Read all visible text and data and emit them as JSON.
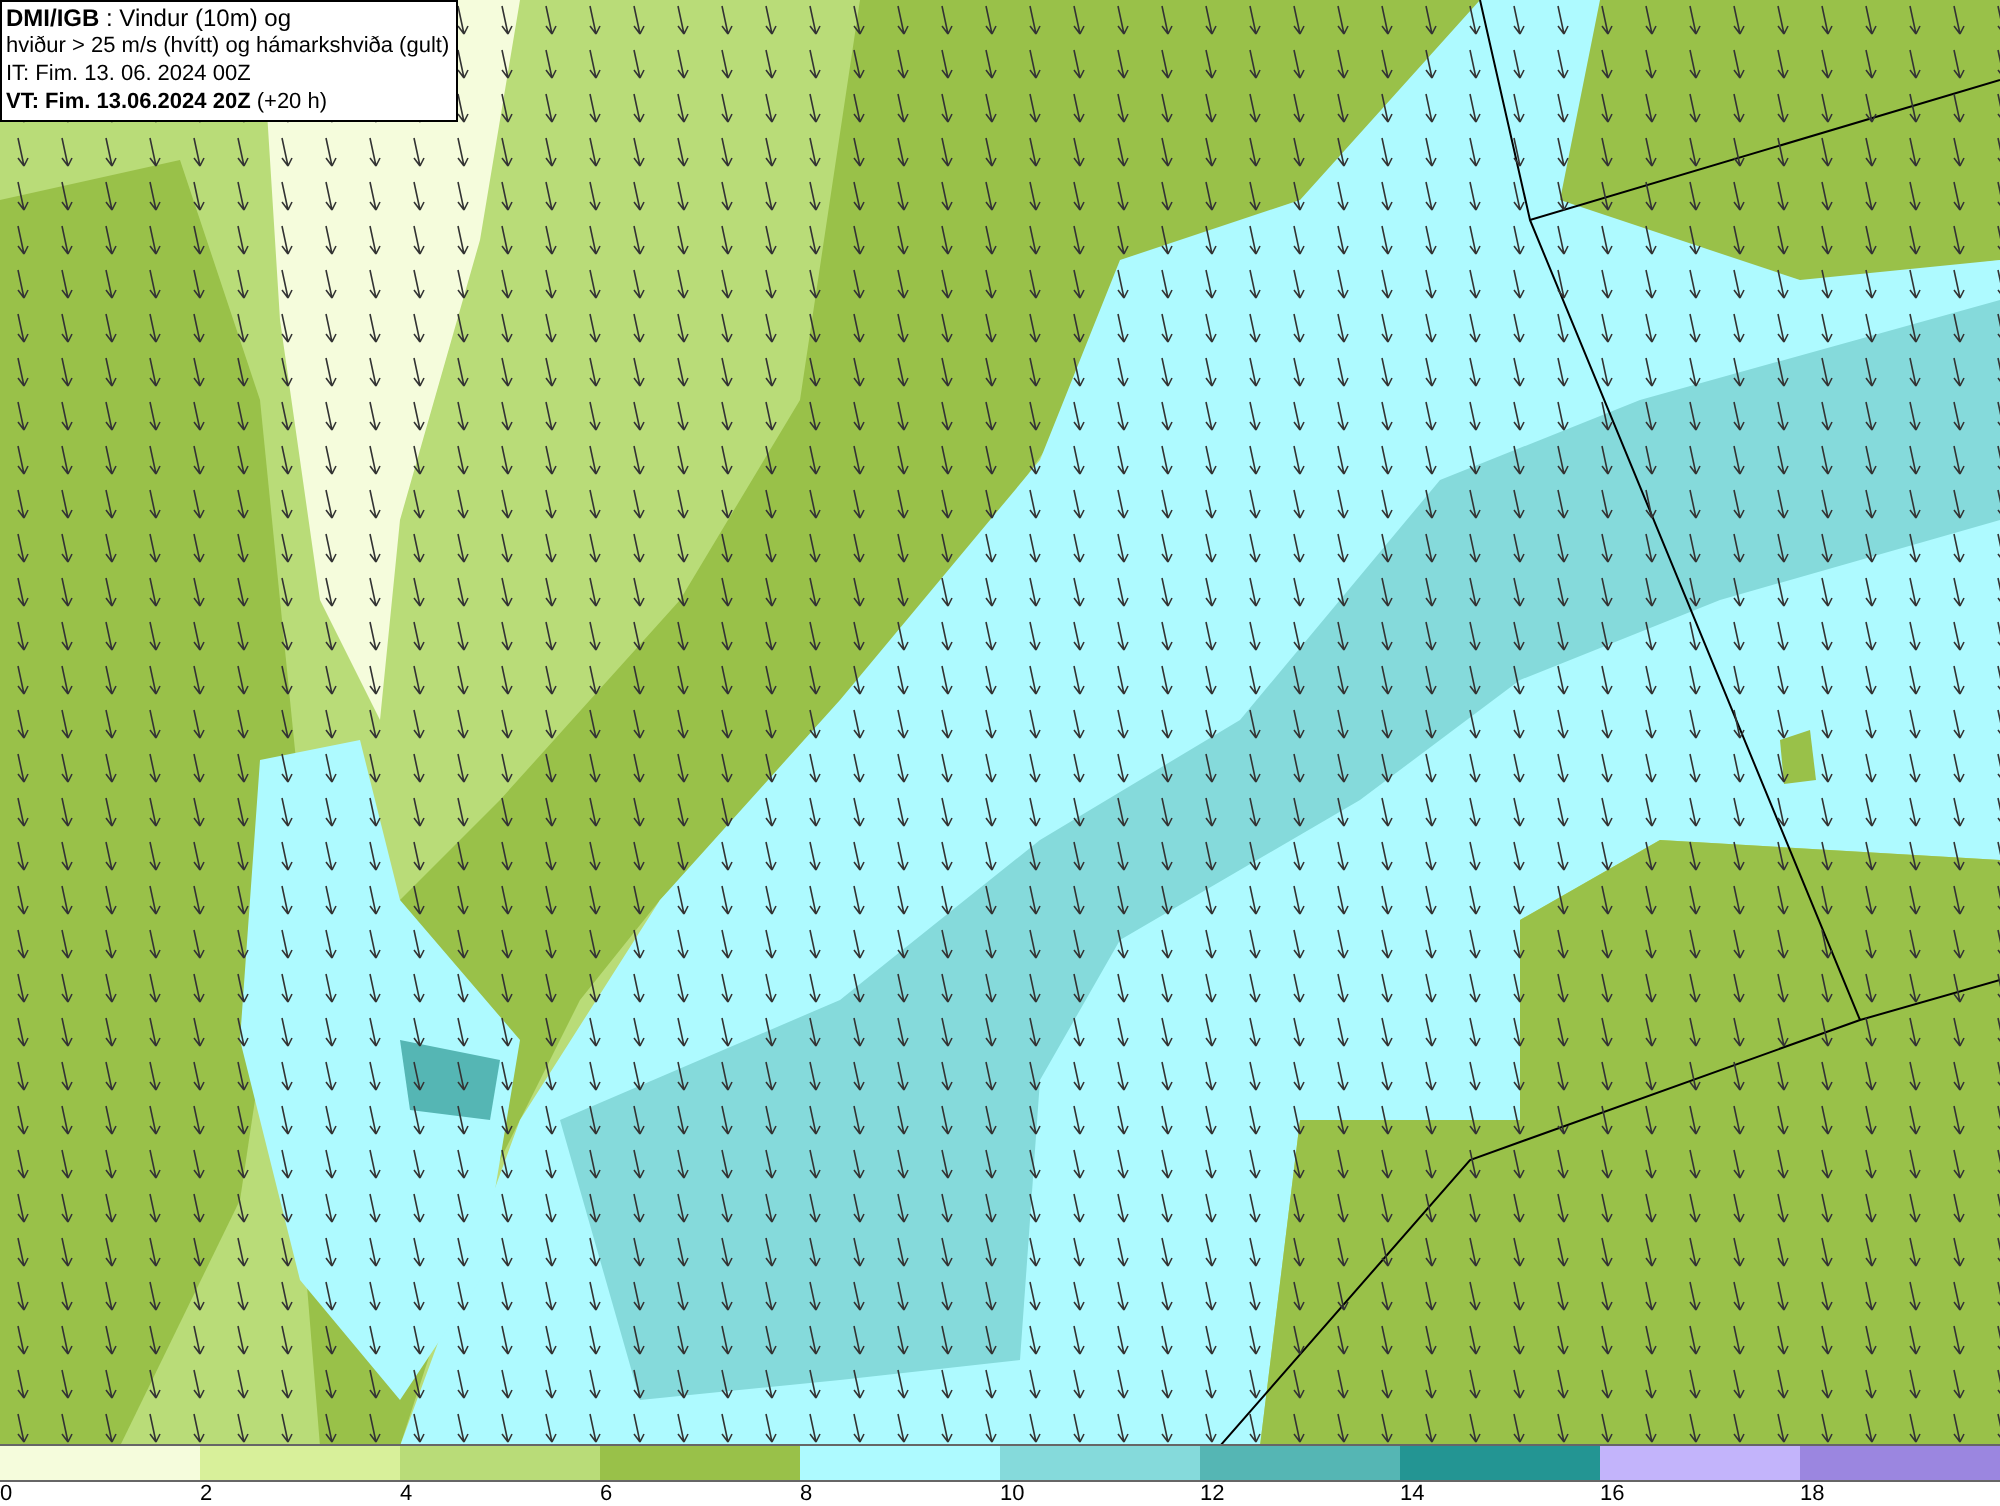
{
  "legend": {
    "lines": [
      "**DMI/IGB** : Vindur (10m) og",
      "hviður > 25 m/s (hvítt) og hámarkshviða (gult)",
      "IT: Fim. 13. 06. 2024 00Z",
      "**VT: Fim. 13.06.2024 20Z** (+20 h)"
    ]
  },
  "colorbar": {
    "swatches": [
      {
        "color": "#f5fcdc"
      },
      {
        "color": "#d8f09a"
      },
      {
        "color": "#b9dc78"
      },
      {
        "color": "#99c149"
      },
      {
        "color": "#aefaff"
      },
      {
        "color": "#85dadb"
      },
      {
        "color": "#55b6b4"
      },
      {
        "color": "#239593"
      },
      {
        "color": "#c3b4fb"
      },
      {
        "color": "#9b86e0"
      }
    ],
    "ticks": [
      "0",
      "2",
      "4",
      "6",
      "8",
      "10",
      "12",
      "14",
      "16",
      "18"
    ]
  }
}
